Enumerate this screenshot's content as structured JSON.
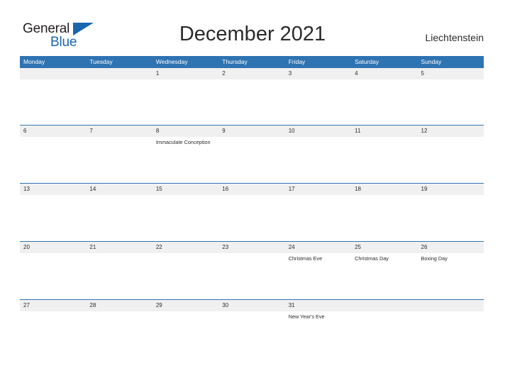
{
  "logo": {
    "word_one": "General",
    "word_two": "Blue",
    "triangle_icon": "triangle-icon",
    "accent_color": "#1a66ae"
  },
  "header": {
    "title": "December 2021",
    "country": "Liechtenstein",
    "header_bg_color": "#2e73b2",
    "band_bg_color": "#f0f0f0"
  },
  "calendar": {
    "weekdays": [
      "Monday",
      "Tuesday",
      "Wednesday",
      "Thursday",
      "Friday",
      "Saturday",
      "Sunday"
    ],
    "weeks": [
      {
        "height_class": "h-80",
        "days": [
          {
            "number": "",
            "holiday": ""
          },
          {
            "number": "",
            "holiday": ""
          },
          {
            "number": "1",
            "holiday": ""
          },
          {
            "number": "2",
            "holiday": ""
          },
          {
            "number": "3",
            "holiday": ""
          },
          {
            "number": "4",
            "holiday": ""
          },
          {
            "number": "5",
            "holiday": ""
          }
        ]
      },
      {
        "height_class": "h-81",
        "days": [
          {
            "number": "6",
            "holiday": ""
          },
          {
            "number": "7",
            "holiday": ""
          },
          {
            "number": "8",
            "holiday": "Immaculate Conception"
          },
          {
            "number": "9",
            "holiday": ""
          },
          {
            "number": "10",
            "holiday": ""
          },
          {
            "number": "11",
            "holiday": ""
          },
          {
            "number": "12",
            "holiday": ""
          }
        ]
      },
      {
        "height_class": "h-81",
        "days": [
          {
            "number": "13",
            "holiday": ""
          },
          {
            "number": "14",
            "holiday": ""
          },
          {
            "number": "15",
            "holiday": ""
          },
          {
            "number": "16",
            "holiday": ""
          },
          {
            "number": "17",
            "holiday": ""
          },
          {
            "number": "18",
            "holiday": ""
          },
          {
            "number": "19",
            "holiday": ""
          }
        ]
      },
      {
        "height_class": "h-81",
        "days": [
          {
            "number": "20",
            "holiday": ""
          },
          {
            "number": "21",
            "holiday": ""
          },
          {
            "number": "22",
            "holiday": ""
          },
          {
            "number": "23",
            "holiday": ""
          },
          {
            "number": "24",
            "holiday": "Christmas Eve"
          },
          {
            "number": "25",
            "holiday": "Christmas Day"
          },
          {
            "number": "26",
            "holiday": "Boxing Day"
          }
        ]
      },
      {
        "height_class": "h-43",
        "days": [
          {
            "number": "27",
            "holiday": ""
          },
          {
            "number": "28",
            "holiday": ""
          },
          {
            "number": "29",
            "holiday": ""
          },
          {
            "number": "30",
            "holiday": ""
          },
          {
            "number": "31",
            "holiday": "New Year's Eve"
          },
          {
            "number": "",
            "holiday": ""
          },
          {
            "number": "",
            "holiday": ""
          }
        ]
      }
    ]
  }
}
